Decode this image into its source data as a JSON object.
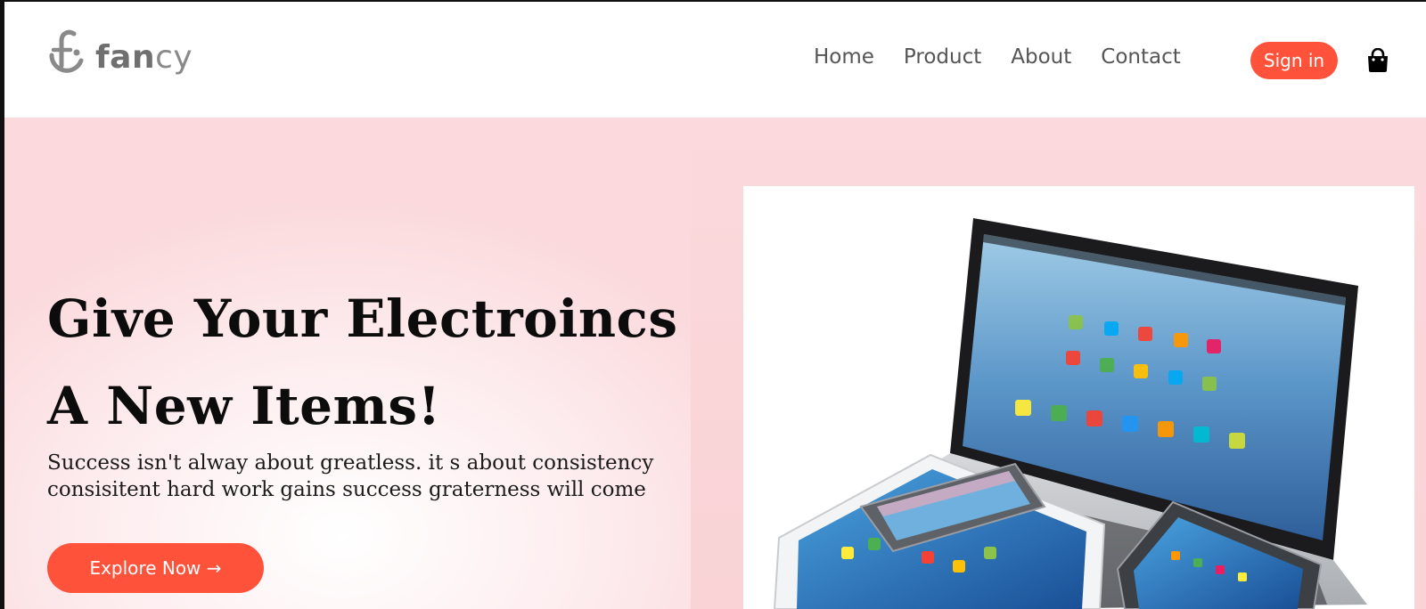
{
  "brand": {
    "name_bold": "fan",
    "name_light": "cy",
    "accent": "#ff523b"
  },
  "nav": {
    "items": [
      "Home",
      "Product",
      "About",
      "Contact"
    ],
    "signin_label": "Sign in",
    "cart_icon": "shopping-bag-icon"
  },
  "hero": {
    "title_line1": "Give Your Electroincs",
    "title_line2": "A New Items!",
    "subtitle_line1": "Success isn't alway about greatless. it s about consistency",
    "subtitle_line2": "consisitent hard work gains success graterness will come",
    "cta_label": "Explore Now →",
    "image": "laptop-tablet-phones-image",
    "background": "#fbd9dc"
  }
}
